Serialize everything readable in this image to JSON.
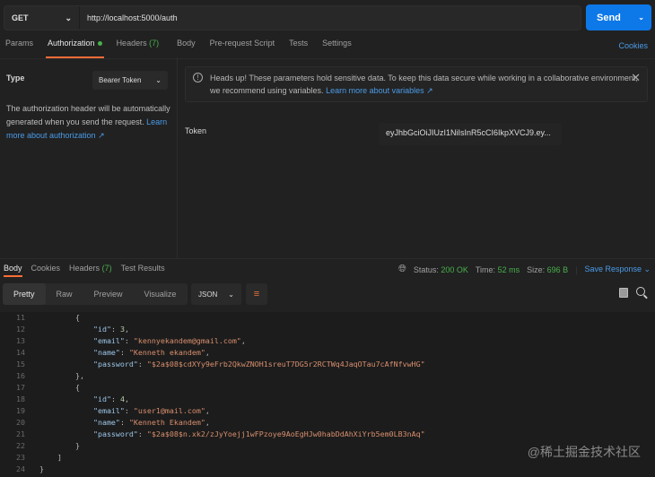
{
  "request": {
    "method": "GET",
    "url": "http://localhost:5000/auth",
    "send_label": "Send"
  },
  "tabs": [
    {
      "label": "Params"
    },
    {
      "label": "Authorization"
    },
    {
      "label": "Headers",
      "count": "(7)"
    },
    {
      "label": "Body"
    },
    {
      "label": "Pre-request Script"
    },
    {
      "label": "Tests"
    },
    {
      "label": "Settings"
    }
  ],
  "cookies_label": "Cookies",
  "auth": {
    "type_label": "Type",
    "type_value": "Bearer Token",
    "description": "The authorization header will be automatically generated when you send the request.",
    "learn_more": "Learn more about authorization ↗",
    "warning": "Heads up! These parameters hold sensitive data. To keep this data secure while working in a collaborative environment, we recommend using variables.",
    "warning_link": "Learn more about variables ↗",
    "token_label": "Token",
    "token_value": "eyJhbGciOiJIUzI1NiIsInR5cCI6IkpXVCJ9.ey..."
  },
  "response": {
    "tabs": [
      {
        "label": "Body"
      },
      {
        "label": "Cookies"
      },
      {
        "label": "Headers",
        "count": "(7)"
      },
      {
        "label": "Test Results"
      }
    ],
    "status_label": "Status:",
    "status": "200 OK",
    "time_label": "Time:",
    "time": "52 ms",
    "size_label": "Size:",
    "size": "696 B",
    "save_label": "Save Response",
    "views": [
      "Pretty",
      "Raw",
      "Preview",
      "Visualize"
    ],
    "format": "JSON"
  },
  "code_lines": [
    {
      "n": "11",
      "indent": "        ",
      "text": "{"
    },
    {
      "n": "12",
      "indent": "            ",
      "key": "\"id\"",
      "val": "3",
      "num": true,
      "end": ","
    },
    {
      "n": "13",
      "indent": "            ",
      "key": "\"email\"",
      "val": "\"kennyekandem@gmail.com\"",
      "end": ","
    },
    {
      "n": "14",
      "indent": "            ",
      "key": "\"name\"",
      "val": "\"Kenneth ekandem\"",
      "end": ","
    },
    {
      "n": "15",
      "indent": "            ",
      "key": "\"password\"",
      "val": "\"$2a$08$cdXYy9eFrb2QkwZNOH1sreuT7DG5r2RCTWq4JaqOTau7cAfNfvwHG\"",
      "end": ""
    },
    {
      "n": "16",
      "indent": "        ",
      "text": "},"
    },
    {
      "n": "17",
      "indent": "        ",
      "text": "{"
    },
    {
      "n": "18",
      "indent": "            ",
      "key": "\"id\"",
      "val": "4",
      "num": true,
      "end": ","
    },
    {
      "n": "19",
      "indent": "            ",
      "key": "\"email\"",
      "val": "\"user1@mail.com\"",
      "end": ","
    },
    {
      "n": "20",
      "indent": "            ",
      "key": "\"name\"",
      "val": "\"Kenneth Ekandem\"",
      "end": ","
    },
    {
      "n": "21",
      "indent": "            ",
      "key": "\"password\"",
      "val": "\"$2a$08$n.xk2/zJyYoejj1wFPzoye9AoEgHJw0habDdAhXiYrb5em0LB3nAq\"",
      "end": ""
    },
    {
      "n": "22",
      "indent": "        ",
      "text": "}"
    },
    {
      "n": "23",
      "indent": "    ",
      "text": "]"
    },
    {
      "n": "24",
      "indent": "",
      "text": "}"
    }
  ],
  "watermark": "@稀土掘金技术社区"
}
